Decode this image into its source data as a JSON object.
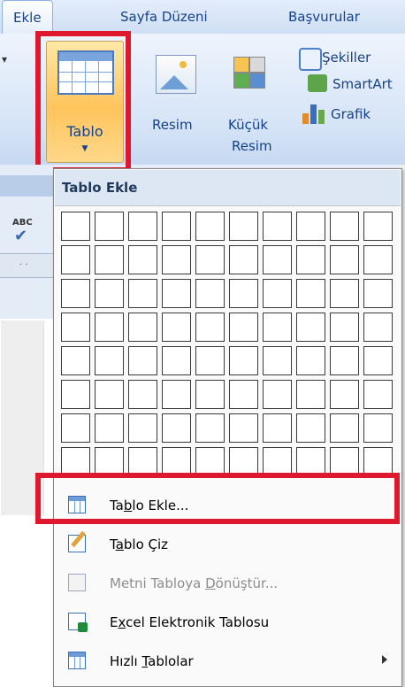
{
  "tabs": [
    "Ekle",
    "Sayfa Düzeni",
    "Başvurular"
  ],
  "ribbon": {
    "tablo": {
      "label": "Tablo"
    },
    "resim": {
      "label": "Resim"
    },
    "kucuk_resim": {
      "line1": "Küçük",
      "line2": "Resim"
    },
    "sekiller": {
      "label": "Şekiller"
    },
    "smartart": {
      "label": "SmartArt"
    },
    "grafik": {
      "label": "Grafik"
    }
  },
  "dropdown": {
    "header": "Tablo Ekle",
    "grid": {
      "cols": 10,
      "rows": 8
    },
    "items": [
      {
        "label": "Tablo Ekle...",
        "mnemonic_index": 2,
        "icon": "table-icon",
        "enabled": true
      },
      {
        "label": "Tablo Çiz",
        "mnemonic_index": 1,
        "icon": "draw-table-icon",
        "enabled": true
      },
      {
        "label": "Metni Tabloya Dönüştür...",
        "mnemonic_index": 14,
        "icon": "convert-text-icon",
        "enabled": false
      },
      {
        "label": "Excel Elektronik Tablosu",
        "mnemonic_index": 1,
        "icon": "excel-icon",
        "enabled": true
      },
      {
        "label": "Hızlı Tablolar",
        "mnemonic_index": 6,
        "icon": "quick-tables-icon",
        "enabled": true,
        "submenu": true
      }
    ]
  },
  "side": {
    "abc": "ABC"
  },
  "colors": {
    "highlight": "#e0182d",
    "ribbon_text": "#15428b"
  }
}
